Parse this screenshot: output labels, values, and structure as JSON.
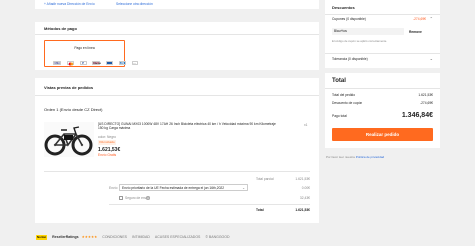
{
  "address": {
    "add_link": "+ Añadir nueva Dirección de Envío",
    "select_link": "Seleccione otra dirección"
  },
  "payment": {
    "title": "Métodos de pago",
    "option_label": "Pago en línea",
    "icons": [
      "visa-icon",
      "mastercard-icon",
      "paypal-icon",
      "klarna-icon",
      "bank-icon",
      "amex-icon",
      "more-icon"
    ],
    "icon_texts": [
      "VISA",
      "",
      "P",
      "Klarna",
      "",
      "AM",
      "···"
    ]
  },
  "orders": {
    "title": "Vistas previas de pedidos",
    "order_header": "Orden 1 (Envío desde CZ Direct)",
    "product": {
      "title": "[US DIRECTO] GUNAI MX03 1000W 48V 17AH 26 Inch Bicicleta eléctrica 40 km / h Velocidad máxima 90 km Kilometraje 150 kg Carga máxima",
      "color": "color: Negro",
      "badge": "IVA incluido",
      "price": "1.621,53€",
      "shipping_note": "Envío Gratis",
      "qty": "x1"
    },
    "summary": {
      "subtotal_label": "Total parcial",
      "subtotal_value": "1.621,53€",
      "envio_label": "Envío",
      "envio_select": "Envío prioritario de la UE Fecha estimada de entrega el jun 16th,2022",
      "envio_value": "0.00€",
      "insurance_label": "Seguro de envío",
      "insurance_value": "32,43€",
      "total_label": "Total",
      "total_value": "1.621,53€"
    }
  },
  "discounts": {
    "title": "Descuentos",
    "coupons_label": "Cupones (0 disponible)",
    "coupons_value": "-274,69€",
    "coupon_code": "Blau+tos",
    "remove_label": "Remove",
    "coupon_note": "El código de cupón se aplicó correctamente.",
    "tolerancia_label": "Tolerancia (0 disponible)"
  },
  "totals": {
    "title": "Total",
    "order_total_label": "Total del pedido",
    "order_total_value": "1.621,53€",
    "coupon_discount_label": "Descuento de cupón",
    "coupon_discount_value": "-274,69€",
    "payment_label": "Pago total",
    "payment_value": "1.346,84€",
    "place_order": "Realizar pedido",
    "terms_prefix": "Por favor leer nuestra",
    "terms_link": "Política de privacidad"
  },
  "footer": {
    "brand1": "Norton",
    "brand2": "ResellerRatings",
    "stars": "★★★★★",
    "links": [
      "CONDICIONES",
      "INTIMIDAD",
      "ACUSES ESPECIALIZADOS",
      "© BANGGOOD"
    ]
  },
  "colors": {
    "accent": "#ff6a1f",
    "background": "#f0f0f0",
    "link": "#2a6ad8"
  }
}
